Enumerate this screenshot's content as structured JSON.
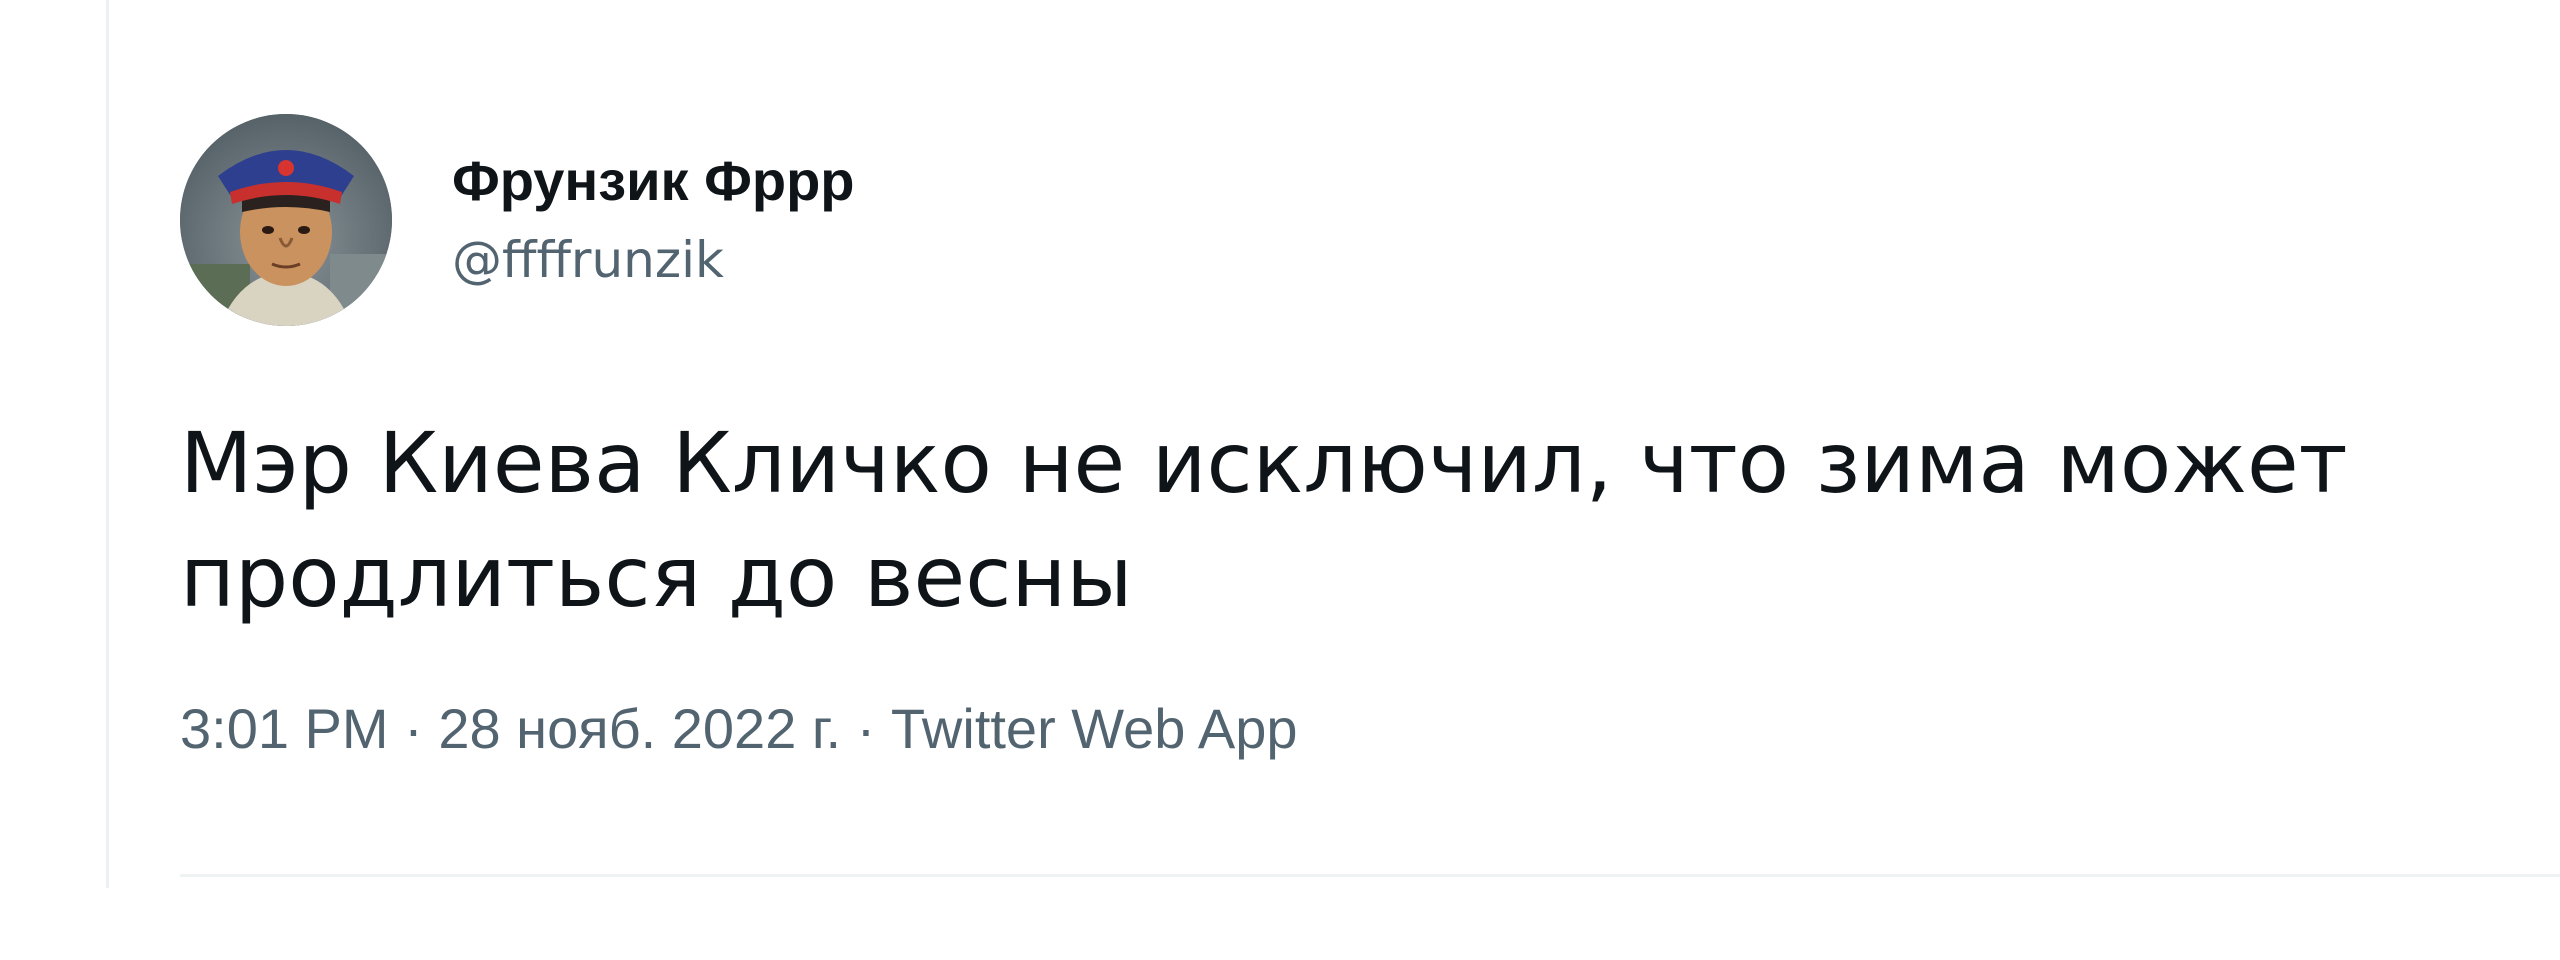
{
  "tweet": {
    "author": {
      "display_name": "Фрунзик Фррр",
      "handle": "@ffffrunzik"
    },
    "text": "Мэр Киева Кличко не исключил, что зима может\nпродлиться до весны",
    "meta": {
      "time": "3:01 PM",
      "separator": " · ",
      "date": "28 нояб. 2022 г.",
      "source": "Twitter Web App"
    }
  },
  "colors": {
    "text_primary": "#0f1419",
    "text_secondary": "#536471",
    "divider": "#eff3f4"
  }
}
